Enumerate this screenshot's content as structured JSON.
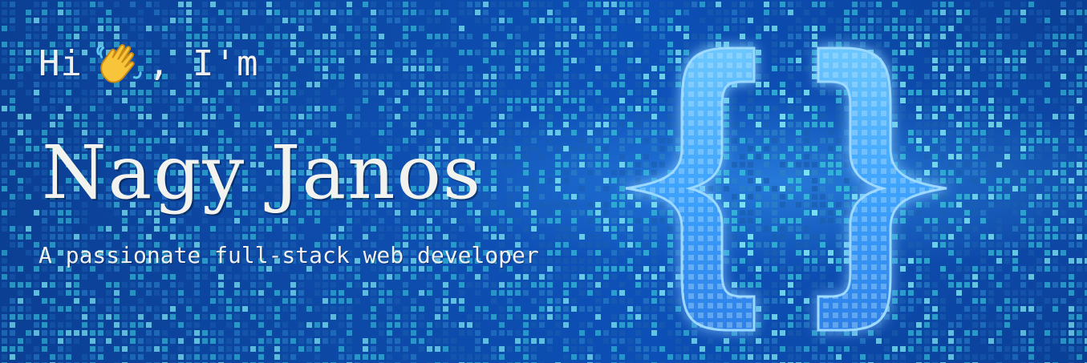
{
  "banner": {
    "greeting_before": "Hi",
    "greeting_after": ", I'm",
    "name": "Nagy Janos",
    "tagline": "A passionate full-stack web developer"
  },
  "icons": {
    "wave": "waving-hand-icon",
    "braces": "curly-braces-icon"
  },
  "colors": {
    "background": "#0c4aa8",
    "matrix_cyan": "#3ad0e8",
    "braces_glow": "#4fb4ff",
    "text": "#eef0f2"
  }
}
